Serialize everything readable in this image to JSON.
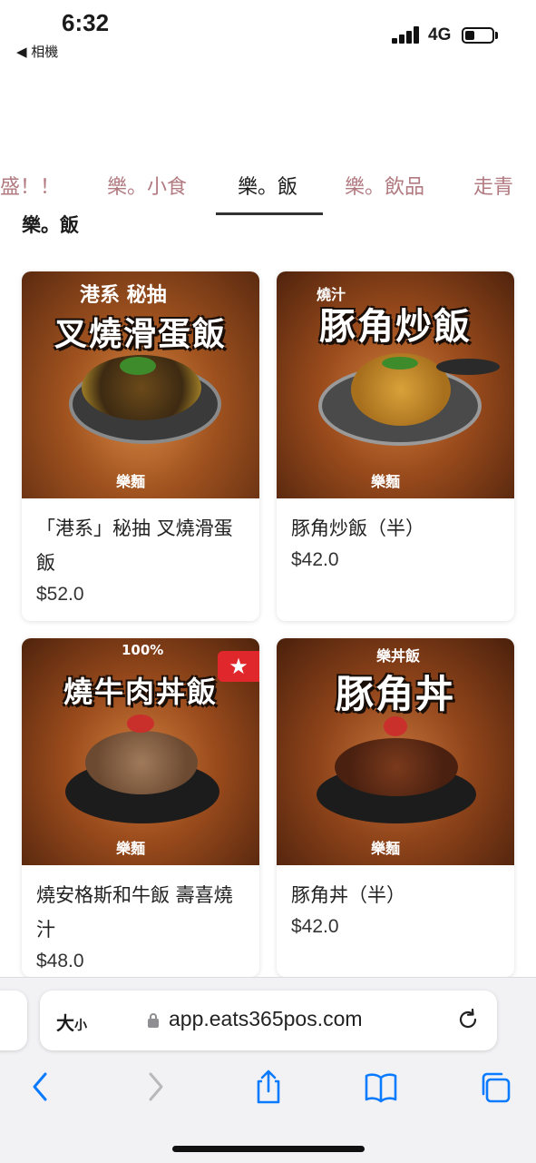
{
  "status_bar": {
    "time": "6:32",
    "back_app": "◀ 相機",
    "network": "4G",
    "battery_level": 0.35
  },
  "tabs": [
    {
      "label": "盛！！",
      "active": false
    },
    {
      "label": "樂。小食",
      "active": false
    },
    {
      "label": "樂。飯",
      "active": true
    },
    {
      "label": "樂。飲品",
      "active": false
    },
    {
      "label": "走青",
      "active": false
    }
  ],
  "section_title": "樂。飯",
  "products": [
    {
      "name": "「港系」秘抽 叉燒滑蛋飯",
      "price": "$52.0",
      "headline": "叉燒滑蛋飯",
      "sub": "港系 秘抽",
      "featured": false
    },
    {
      "name": "豚角炒飯（半）",
      "price": "$42.0",
      "headline": "豚角炒飯",
      "sub": "燒汁",
      "featured": false
    },
    {
      "name": "燒安格斯和牛飯 壽喜燒汁",
      "price": "$48.0",
      "headline": "燒牛肉丼飯",
      "sub": "100%",
      "featured": true
    },
    {
      "name": "豚角丼（半）",
      "price": "$42.0",
      "headline": "豚角丼",
      "sub": "樂丼飯",
      "featured": false
    }
  ],
  "featured_badge": "★",
  "browser": {
    "text_size_label": "大",
    "text_size_small": "小",
    "url": "app.eats365pos.com"
  },
  "colors": {
    "tab_inactive": "#b17a80",
    "badge": "#e0272c",
    "ios_blue": "#0a7aff"
  }
}
